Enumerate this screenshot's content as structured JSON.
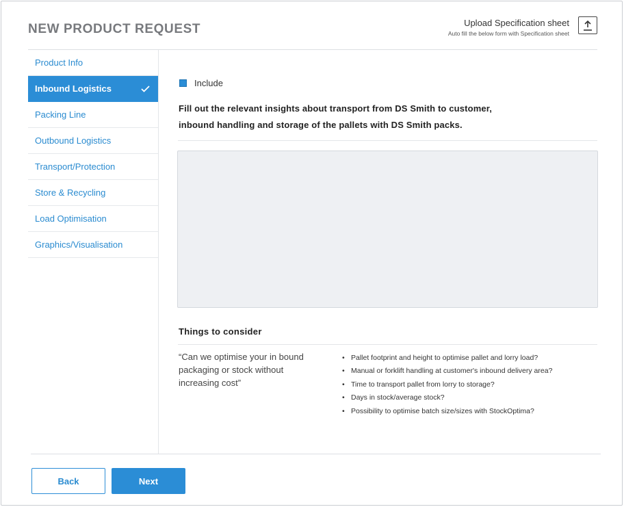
{
  "header": {
    "title": "NEW PRODUCT REQUEST",
    "upload_title": "Upload Specification sheet",
    "upload_subtitle": "Auto fill the below form with Specification sheet",
    "upload_icon": "upload-icon"
  },
  "sidebar": {
    "items": [
      {
        "label": "Product Info",
        "active": false
      },
      {
        "label": "Inbound Logistics",
        "active": true,
        "icon": "checkmark-icon"
      },
      {
        "label": "Packing Line",
        "active": false
      },
      {
        "label": "Outbound Logistics",
        "active": false
      },
      {
        "label": "Transport/Protection",
        "active": false
      },
      {
        "label": "Store & Recycling",
        "active": false
      },
      {
        "label": "Load Optimisation",
        "active": false
      },
      {
        "label": "Graphics/Visualisation",
        "active": false
      }
    ]
  },
  "main": {
    "include_label": "Include",
    "include_checked": true,
    "intro_line1": "Fill out the relevant insights about transport from DS Smith to customer,",
    "intro_line2": "inbound handling and storage of the pallets with DS Smith packs.",
    "textarea_value": "",
    "consider_title": "Things to consider",
    "quote": "“Can we optimise your in bound packaging or stock without increasing cost”",
    "bullets": [
      "Pallet footprint and height to optimise pallet and lorry load?",
      "Manual or forklift handling at customer's inbound delivery area?",
      "Time to transport pallet from lorry to storage?",
      "Days in stock/average stock?",
      "Possibility to optimise batch size/sizes with StockOptima?"
    ]
  },
  "footer": {
    "back_label": "Back",
    "next_label": "Next"
  },
  "colors": {
    "accent": "#2b8dd6",
    "link": "#2a8bd0",
    "title_gray": "#77797d",
    "textarea_bg": "#eef0f3"
  }
}
